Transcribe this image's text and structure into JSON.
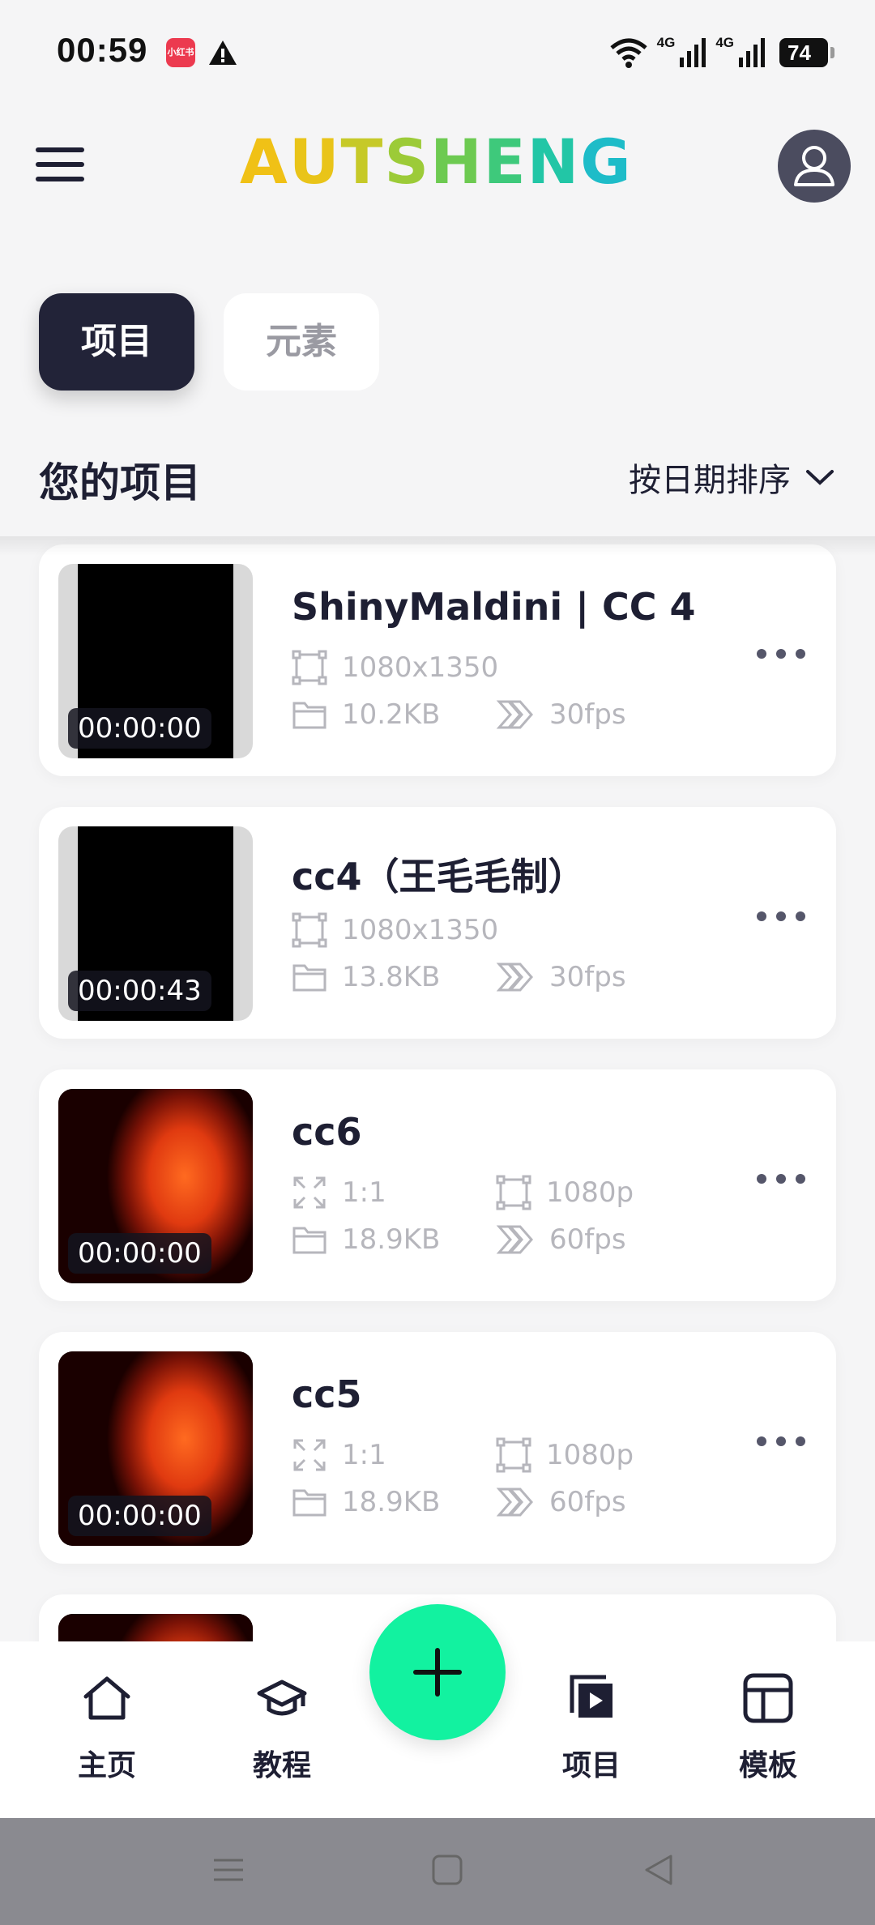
{
  "status_bar": {
    "time": "00:59",
    "app_badge": "小红书",
    "network_1": "4G",
    "network_2": "4G",
    "battery": "74"
  },
  "header": {
    "logo_text": "AUTSHENG",
    "logo_colors": [
      "#f0c116",
      "#e9c419",
      "#c6c928",
      "#9ccb38",
      "#6dca51",
      "#3ec97b",
      "#22c6a6",
      "#1ebcc8"
    ]
  },
  "tabs": [
    {
      "label": "项目",
      "active": true
    },
    {
      "label": "元素",
      "active": false
    }
  ],
  "section": {
    "title": "您的项目",
    "sort_label": "按日期排序"
  },
  "projects": [
    {
      "title": "ShinyMaldini | CC 4",
      "duration": "00:00:00",
      "resolution": "1080x1350",
      "size": "10.2KB",
      "fps": "30fps",
      "thumb": "black"
    },
    {
      "title": "cc4（王毛毛制）",
      "duration": "00:00:43",
      "resolution": "1080x1350",
      "size": "13.8KB",
      "fps": "30fps",
      "thumb": "black"
    },
    {
      "title": "cc6",
      "duration": "00:00:00",
      "ratio": "1:1",
      "quality": "1080p",
      "size": "18.9KB",
      "fps": "60fps",
      "thumb": "red"
    },
    {
      "title": "cc5",
      "duration": "00:00:00",
      "ratio": "1:1",
      "quality": "1080p",
      "size": "18.9KB",
      "fps": "60fps",
      "thumb": "red"
    }
  ],
  "bottom_nav": [
    {
      "label": "主页",
      "icon": "home-icon"
    },
    {
      "label": "教程",
      "icon": "graduation-cap-icon"
    },
    {
      "label": "项目",
      "icon": "projects-icon"
    },
    {
      "label": "模板",
      "icon": "templates-icon"
    }
  ],
  "colors": {
    "accent": "#12f2a0",
    "dark": "#222338",
    "background": "#f5f5f6"
  }
}
